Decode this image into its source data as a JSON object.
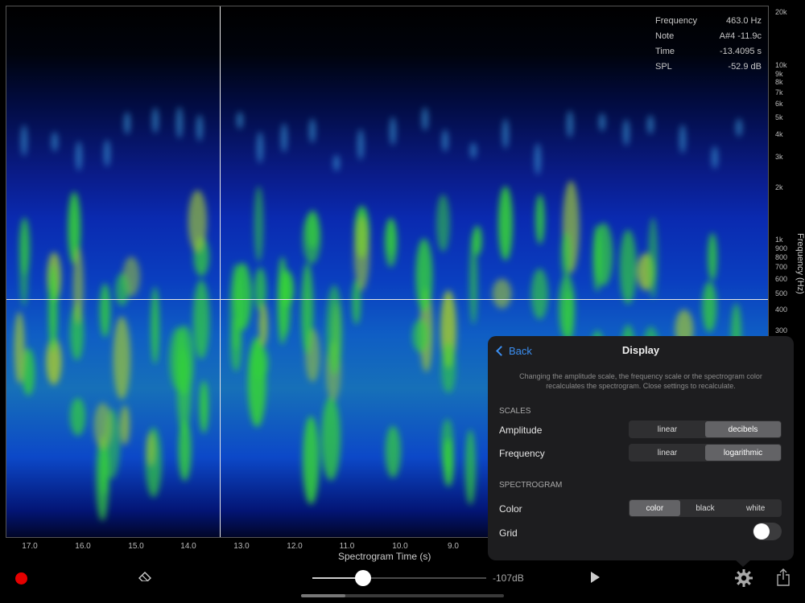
{
  "readout": [
    {
      "label": "Frequency",
      "value": "463.0 Hz"
    },
    {
      "label": "Note",
      "value": "A#4 -11.9c"
    },
    {
      "label": "Time",
      "value": "-13.4095 s"
    },
    {
      "label": "SPL",
      "value": "-52.9 dB"
    }
  ],
  "frequency_axis": {
    "title": "Frequency (Hz)",
    "ticks": [
      "20k",
      "10k",
      "9k",
      "8k",
      "7k",
      "6k",
      "5k",
      "4k",
      "3k",
      "2k",
      "1k",
      "900",
      "800",
      "700",
      "600",
      "500",
      "400",
      "300"
    ]
  },
  "time_axis": {
    "title": "Spectrogram Time (s)",
    "ticks": [
      "17.0",
      "16.0",
      "15.0",
      "14.0",
      "13.0",
      "12.0",
      "11.0",
      "10.0",
      "9.0"
    ]
  },
  "toolbar": {
    "record_icon": "record-icon",
    "eraser_icon": "eraser-icon",
    "gain_fraction": 0.29,
    "db_label": "-107dB",
    "play_icon": "play-icon",
    "settings_icon": "gear-icon",
    "share_icon": "share-icon"
  },
  "display_panel": {
    "back_label": "Back",
    "title": "Display",
    "description": "Changing the amplitude scale, the frequency scale or the spectrogram color recalculates the spectrogram. Close settings to recalculate.",
    "scales_header": "SCALES",
    "amplitude": {
      "label": "Amplitude",
      "options": [
        "linear",
        "decibels"
      ],
      "selected": "decibels"
    },
    "frequency": {
      "label": "Frequency",
      "options": [
        "linear",
        "logarithmic"
      ],
      "selected": "logarithmic"
    },
    "spectrogram_header": "SPECTROGRAM",
    "color": {
      "label": "Color",
      "options": [
        "color",
        "black",
        "white"
      ],
      "selected": "color"
    },
    "grid": {
      "label": "Grid",
      "on": false
    }
  },
  "colors": {
    "accent": "#3b8ff2",
    "record": "#e50000",
    "crosshair": "#e8e8e8"
  }
}
